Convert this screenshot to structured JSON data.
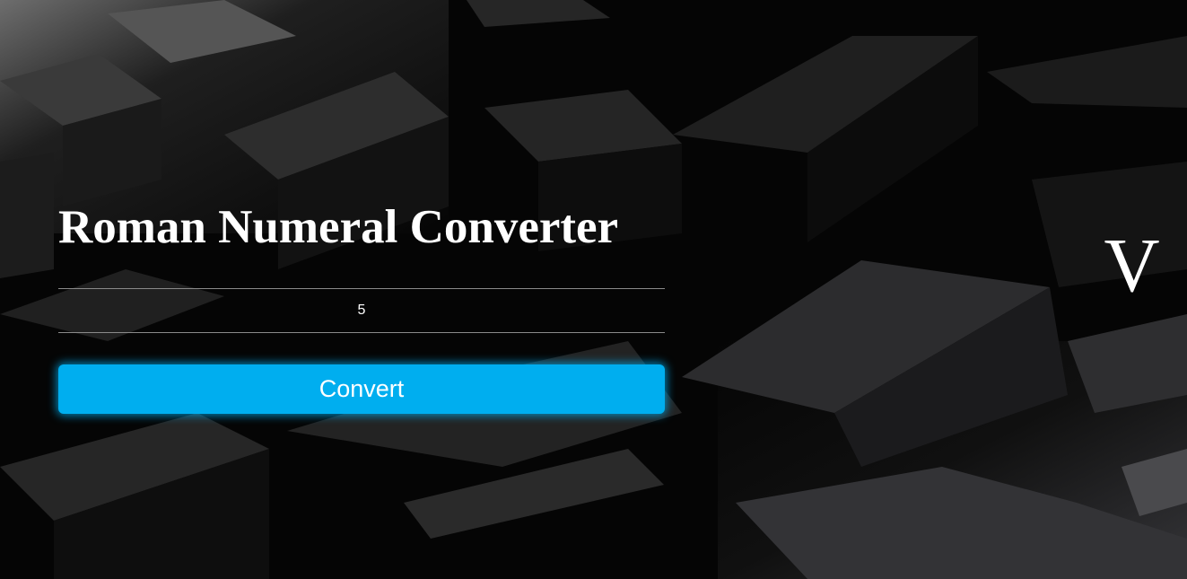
{
  "app": {
    "title": "Roman Numeral Converter"
  },
  "form": {
    "number_value": "5",
    "convert_label": "Convert"
  },
  "result": {
    "roman_numeral": "V"
  },
  "colors": {
    "accent": "#00aeef",
    "text": "#ffffff",
    "background": "#000000"
  }
}
